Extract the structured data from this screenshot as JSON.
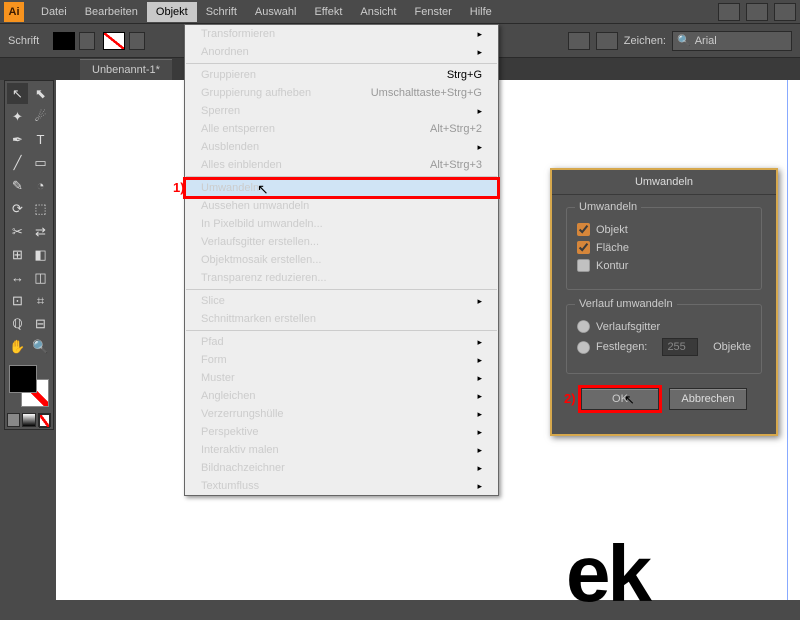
{
  "app": {
    "logo": "Ai"
  },
  "menubar": [
    "Datei",
    "Bearbeiten",
    "Objekt",
    "Schrift",
    "Auswahl",
    "Effekt",
    "Ansicht",
    "Fenster",
    "Hilfe"
  ],
  "menubar_open_index": 2,
  "ctrlbar": {
    "label": "Schrift",
    "zeichen_label": "Zeichen:",
    "font": "Arial"
  },
  "doctab": "Unbenannt-1*",
  "tools": [
    "↖",
    "⬉",
    "✦",
    "☄",
    "✒",
    "T",
    "╱",
    "▭",
    "✎",
    "◔",
    "⟳",
    "⬚",
    "✂",
    "⇄",
    "⊞",
    "◧",
    "↔",
    "◫",
    "⊡",
    "⌗",
    "ℚ",
    "⊟",
    "✋",
    "🔍"
  ],
  "dropdown": {
    "groups": [
      [
        {
          "l": "Transformieren",
          "sub": true
        },
        {
          "l": "Anordnen",
          "sub": true
        }
      ],
      [
        {
          "l": "Gruppieren",
          "sc": "Strg+G"
        },
        {
          "l": "Gruppierung aufheben",
          "sc": "Umschalttaste+Strg+G",
          "dis": true
        },
        {
          "l": "Sperren",
          "sub": true
        },
        {
          "l": "Alle entsperren",
          "sc": "Alt+Strg+2",
          "dis": true
        },
        {
          "l": "Ausblenden",
          "sub": true
        },
        {
          "l": "Alles einblenden",
          "sc": "Alt+Strg+3",
          "dis": true
        }
      ],
      [
        {
          "l": "Umwandeln",
          "hl": true
        },
        {
          "l": "Aussehen umwandeln",
          "dis": true
        },
        {
          "l": "In Pixelbild umwandeln..."
        },
        {
          "l": "Verlaufsgitter erstellen..."
        },
        {
          "l": "Objektmosaik erstellen...",
          "dis": true
        },
        {
          "l": "Transparenz reduzieren..."
        }
      ],
      [
        {
          "l": "Slice",
          "sub": true
        },
        {
          "l": "Schnittmarken erstellen"
        }
      ],
      [
        {
          "l": "Pfad",
          "sub": true
        },
        {
          "l": "Form",
          "sub": true
        },
        {
          "l": "Muster",
          "sub": true
        },
        {
          "l": "Angleichen",
          "sub": true
        },
        {
          "l": "Verzerrungshülle",
          "sub": true
        },
        {
          "l": "Perspektive",
          "sub": true
        },
        {
          "l": "Interaktiv malen",
          "sub": true
        },
        {
          "l": "Bildnachzeichner",
          "sub": true
        },
        {
          "l": "Textumfluss",
          "sub": true
        }
      ]
    ],
    "callout": "1)"
  },
  "dialog": {
    "title": "Umwandeln",
    "grp1": "Umwandeln",
    "chk_objekt": "Objekt",
    "chk_flaeche": "Fläche",
    "chk_kontur": "Kontur",
    "grp2": "Verlauf umwandeln",
    "rad_gitter": "Verlaufsgitter",
    "rad_fest": "Festlegen:",
    "fest_val": "255",
    "fest_unit": "Objekte",
    "ok": "OK",
    "cancel": "Abbrechen",
    "callout": "2)"
  },
  "canvas": {
    "bigtext": "ek"
  }
}
